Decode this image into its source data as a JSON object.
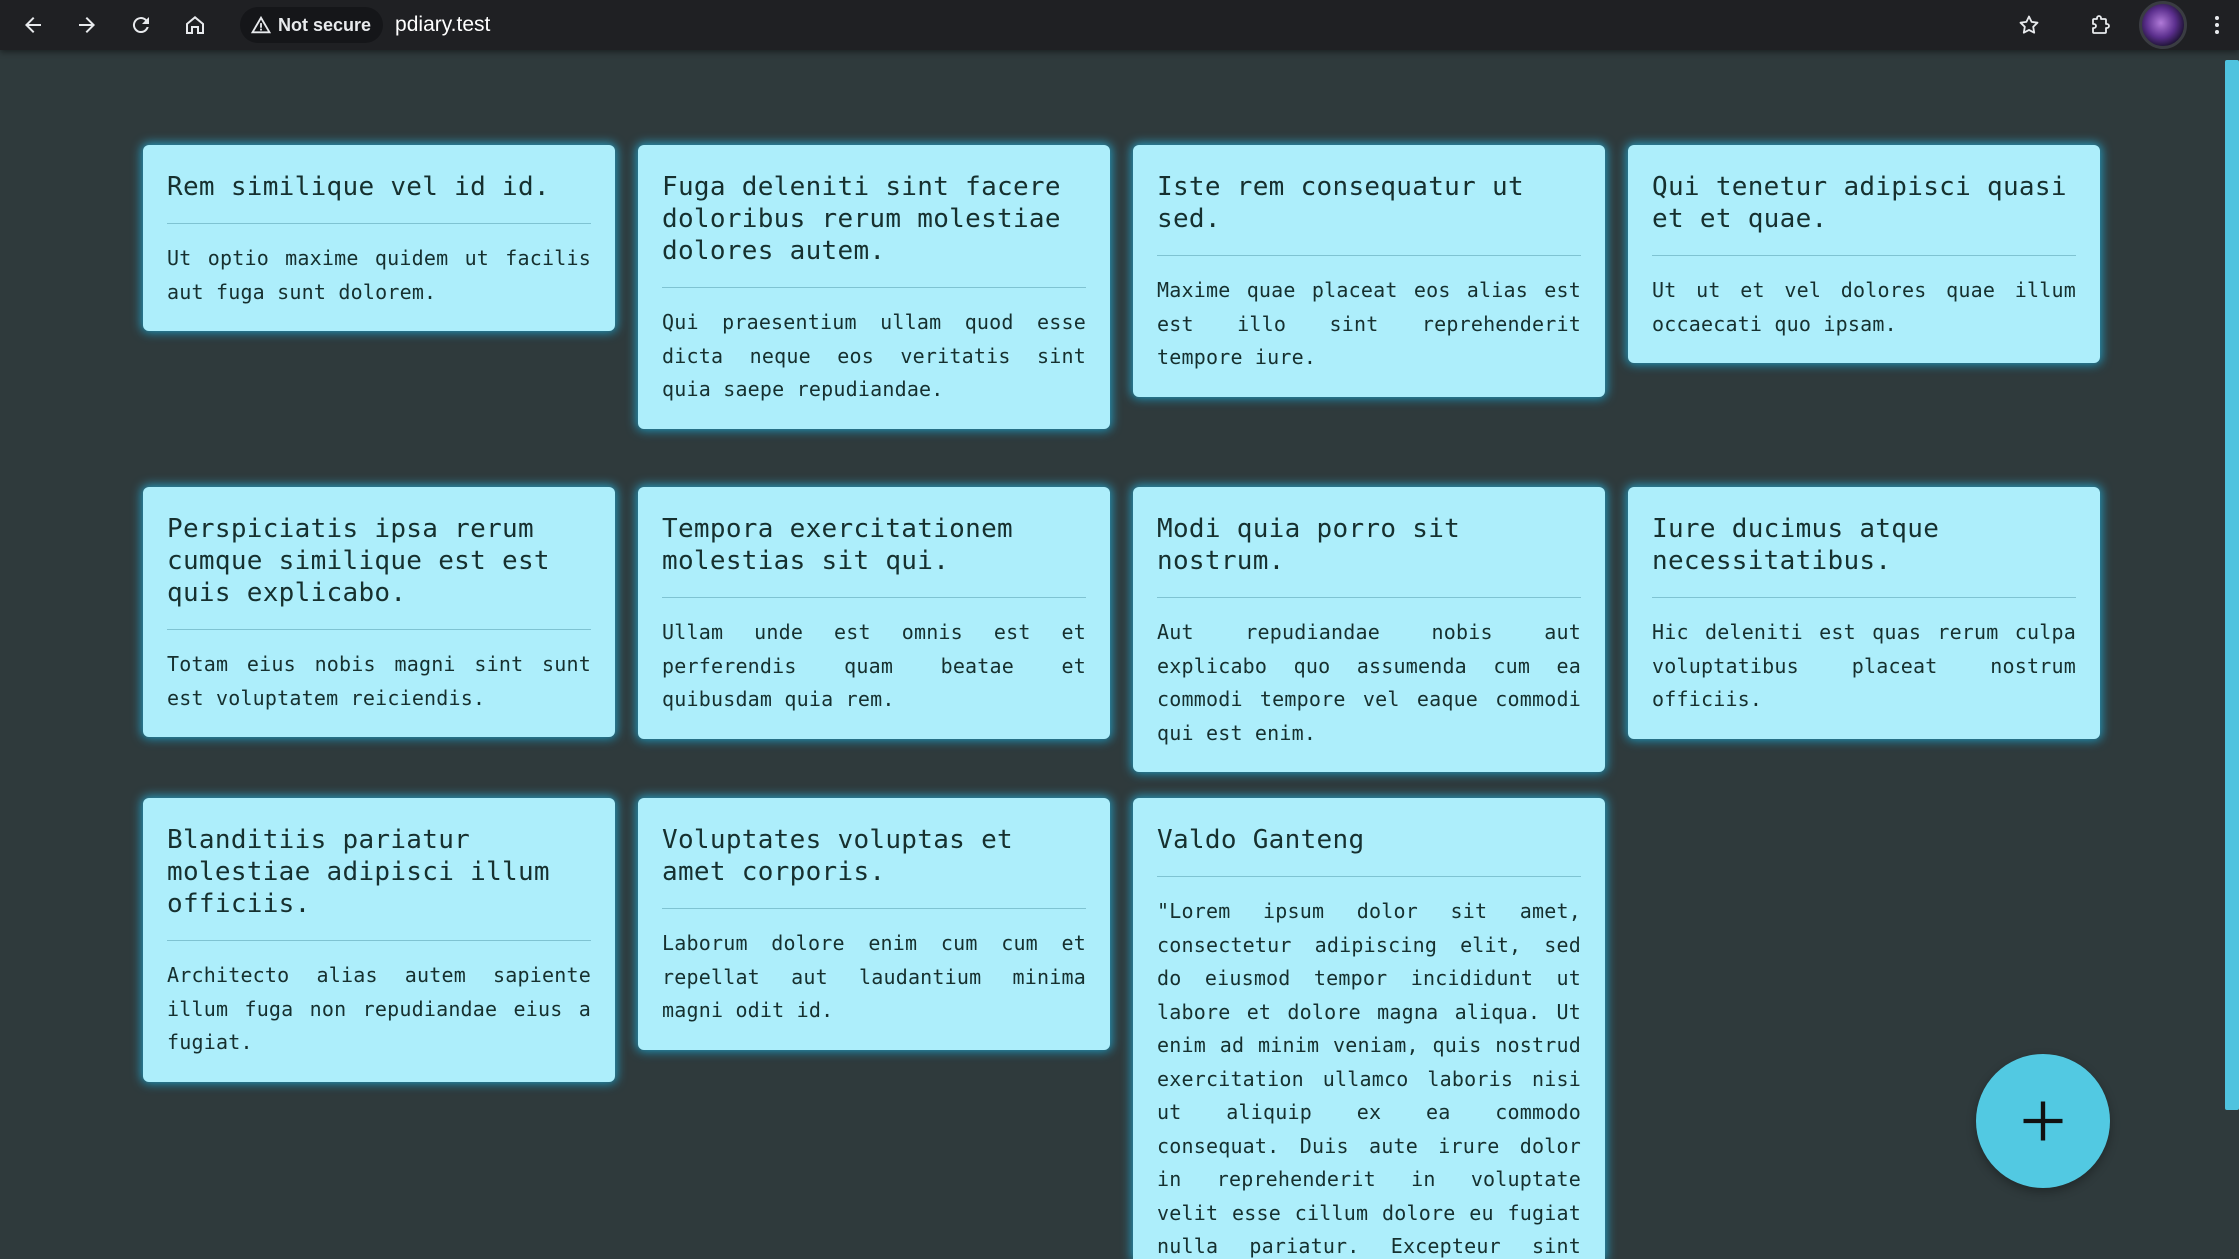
{
  "browser": {
    "security_label": "Not secure",
    "url": "pdiary.test"
  },
  "notes": [
    {
      "title": "Rem similique vel id id.",
      "body": "Ut optio maxime quidem ut facilis aut fuga sunt dolorem."
    },
    {
      "title": "Fuga deleniti sint facere doloribus rerum molestiae dolores autem.",
      "body": "Qui praesentium ullam quod esse dicta neque eos veritatis sint quia saepe repudiandae."
    },
    {
      "title": "Iste rem consequatur ut sed.",
      "body": "Maxime quae placeat eos alias est est illo sint reprehenderit tempore iure."
    },
    {
      "title": "Qui tenetur adipisci quasi et et quae.",
      "body": "Ut ut et vel dolores quae illum occaecati quo ipsam."
    },
    {
      "title": "Perspiciatis ipsa rerum cumque similique est est quis explicabo.",
      "body": "Totam eius nobis magni sint sunt est voluptatem reiciendis."
    },
    {
      "title": "Tempora exercitationem molestias sit qui.",
      "body": "Ullam unde est omnis est et perferendis quam beatae et quibusdam quia rem."
    },
    {
      "title": "Modi quia porro sit nostrum.",
      "body": "Aut repudiandae nobis aut explicabo quo assumenda cum ea commodi tempore vel eaque commodi qui est enim."
    },
    {
      "title": "Iure ducimus atque necessitatibus.",
      "body": "Hic deleniti est quas rerum culpa voluptatibus placeat nostrum officiis."
    },
    {
      "title": "Blanditiis pariatur molestiae adipisci illum officiis.",
      "body": "Architecto alias autem sapiente illum fuga non repudiandae eius a fugiat."
    },
    {
      "title": "Voluptates voluptas et amet corporis.",
      "body": "Laborum dolore enim cum cum et repellat aut laudantium minima magni odit id."
    },
    {
      "title": "Valdo Ganteng",
      "body": "\"Lorem ipsum dolor sit amet, consectetur adipiscing elit, sed do eiusmod tempor incididunt ut labore et dolore magna aliqua. Ut enim ad minim veniam, quis nostrud exercitation ullamco laboris nisi ut aliquip ex ea commodo consequat. Duis aute irure dolor in reprehenderit in voluptate velit esse cillum dolore eu fugiat nulla pariatur. Excepteur sint occaecat"
    }
  ],
  "icons": {
    "back": "arrow-left-icon",
    "forward": "arrow-right-icon",
    "reload": "reload-icon",
    "home": "home-icon",
    "warning": "warning-triangle-icon",
    "bookmark": "star-icon",
    "extensions": "puzzle-icon",
    "menu": "kebab-menu-icon",
    "add": "plus-icon"
  },
  "colors": {
    "page_background": "#2f3a3c",
    "card_background": "#adeefb",
    "card_glow": "#2aafd7",
    "fab_background": "#52c9e2"
  }
}
